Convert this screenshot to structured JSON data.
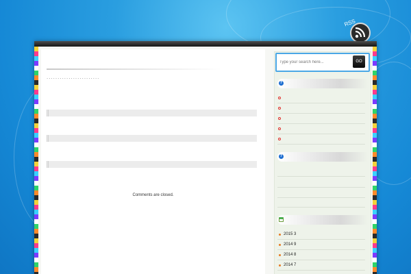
{
  "header": {
    "site_title": "",
    "site_description": ""
  },
  "icons": {
    "rss": "rss-badge-icon",
    "widget": "info-circle-icon",
    "calendar": "calendar-icon"
  },
  "colors": {
    "background": "#1689d6",
    "search_border": "#4aa7e6",
    "bullet": "#e0312f",
    "archive_bullet": "#e77a20"
  },
  "post": {
    "title": "",
    "meta": "........................",
    "comments_status": "Comments are closed."
  },
  "sidebar": {
    "search": {
      "placeholder": "Type your search here...",
      "button_label": "GO"
    },
    "widget1": {
      "title": "",
      "items": [
        "",
        "",
        "",
        "",
        ""
      ]
    },
    "widget2": {
      "title": ""
    },
    "archives": {
      "title": "",
      "items": [
        "2015 3",
        "2014 9",
        "2014 8",
        "2014 7",
        ""
      ]
    }
  },
  "rss_badge_text": "RSS"
}
